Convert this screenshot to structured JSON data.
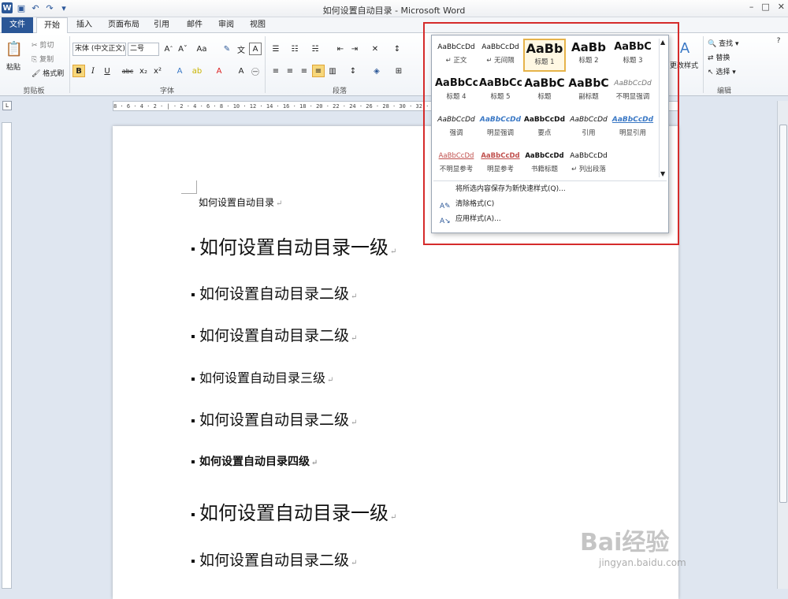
{
  "titlebar": {
    "title": "如何设置自动目录 - Microsoft Word",
    "controls": [
      "–",
      "□",
      "✕"
    ]
  },
  "tabs": [
    "文件",
    "开始",
    "插入",
    "页面布局",
    "引用",
    "邮件",
    "审阅",
    "视图"
  ],
  "ribbon": {
    "clipboard": {
      "paste": "粘贴",
      "cut": "剪切",
      "copy": "复制",
      "format_painter": "格式刷",
      "group": "剪贴板"
    },
    "font": {
      "font_name": "宋体 (中文正文)",
      "font_size": "二号",
      "group": "字体",
      "bold": "B",
      "italic": "I",
      "underline": "U"
    },
    "paragraph": {
      "group": "段落"
    },
    "styles": {
      "change_styles": "更改样式"
    },
    "editing": {
      "find": "查找",
      "replace": "替换",
      "select": "选择",
      "group": "编辑"
    }
  },
  "gallery": {
    "styles": [
      {
        "sample": "AaBbCcDd",
        "label": "↵ 正文"
      },
      {
        "sample": "AaBbCcDd",
        "label": "↵ 无间隔"
      },
      {
        "sample": "AaBb",
        "label": "标题 1"
      },
      {
        "sample": "AaBb",
        "label": "标题 2"
      },
      {
        "sample": "AaBbC",
        "label": "标题 3"
      },
      {
        "sample": "AaBbCc",
        "label": "标题 4"
      },
      {
        "sample": "AaBbCc",
        "label": "标题 5"
      },
      {
        "sample": "AaBbC",
        "label": "标题"
      },
      {
        "sample": "AaBbC",
        "label": "副标题"
      },
      {
        "sample": "AaBbCcDd",
        "label": "不明显强调"
      },
      {
        "sample": "AaBbCcDd",
        "label": "强调"
      },
      {
        "sample": "AaBbCcDd",
        "label": "明显强调"
      },
      {
        "sample": "AaBbCcDd",
        "label": "要点"
      },
      {
        "sample": "AaBbCcDd",
        "label": "引用"
      },
      {
        "sample": "AaBbCcDd",
        "label": "明显引用"
      },
      {
        "sample": "AaBbCcDd",
        "label": "不明显参考"
      },
      {
        "sample": "AaBbCcDd",
        "label": "明显参考"
      },
      {
        "sample": "AaBbCcDd",
        "label": "书籍标题"
      },
      {
        "sample": "AaBbCcDd",
        "label": "↵ 列出段落"
      }
    ],
    "menu": {
      "save": "将所选内容保存为新快速样式(Q)...",
      "clear": "清除格式(C)",
      "apply": "应用样式(A)..."
    }
  },
  "document": {
    "lines": [
      "如何设置自动目录",
      "如何设置自动目录一级",
      "如何设置自动目录二级",
      "如何设置自动目录二级",
      "如何设置自动目录三级",
      "如何设置自动目录二级",
      "如何设置自动目录四级",
      "如何设置自动目录一级",
      "如何设置自动目录二级"
    ]
  },
  "watermark": {
    "text": "Bai经验",
    "url": "jingyan.baidu.com"
  },
  "ruler": {
    "marks": "8 · 6 · 4 · 2 · | · 2 · 4 · 6 · 8 · 10 · 12 · 14 · 16 · 18 · 20 · 22 · 24 · 26 · 28 · 30 · 32 · 34 · 36 · 38 · 40 · 42 · 44 · 46 · 48"
  }
}
